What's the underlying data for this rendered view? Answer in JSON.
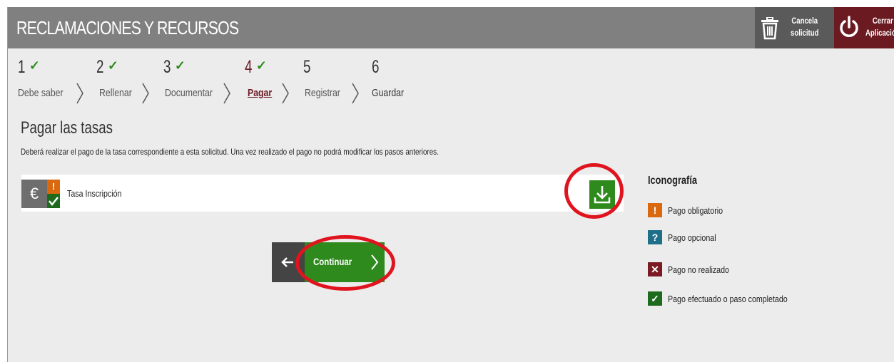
{
  "header": {
    "title": "RECLAMACIONES Y RECURSOS",
    "cancel_label_line1": "Cancela",
    "cancel_label_line2": "solicitud",
    "close_label_line1": "Cerrar",
    "close_label_line2": "Aplicación"
  },
  "steps": [
    {
      "number": "1",
      "label": "Debe saber",
      "completed": true,
      "current": false
    },
    {
      "number": "2",
      "label": "Rellenar",
      "completed": true,
      "current": false
    },
    {
      "number": "3",
      "label": "Documentar",
      "completed": true,
      "current": false
    },
    {
      "number": "4",
      "label": "Pagar",
      "completed": true,
      "current": true
    },
    {
      "number": "5",
      "label": "Registrar",
      "completed": false,
      "current": false
    },
    {
      "number": "6",
      "label": "Guardar",
      "completed": false,
      "current": false
    }
  ],
  "check_symbol": "✓",
  "section": {
    "title": "Pagar las tasas",
    "description": "Deberá realizar el pago de la tasa correspondiente a esta solicitud. Una vez realizado el pago no podrá modificar los pasos anteriores."
  },
  "fee": {
    "currency_symbol": "€",
    "mandatory_symbol": "!",
    "label": "Tasa Inscripción"
  },
  "legend": {
    "title": "Iconografía",
    "items": [
      {
        "symbol": "!",
        "label": "Pago obligatorio",
        "color": "#d9680f"
      },
      {
        "symbol": "?",
        "label": "Pago opcional",
        "color": "#1f6f8b"
      },
      {
        "symbol": "✕",
        "label": "Pago no realizado",
        "color": "#7a1a22"
      },
      {
        "symbol": "✓",
        "label": "Pago efectuado o paso completado",
        "color": "#1e6b1e"
      }
    ]
  },
  "actions": {
    "continue_label": "Continuar"
  },
  "colors": {
    "header": "#808080",
    "accent": "#6b1a22",
    "success": "#2f8a1e",
    "warning": "#d9680f",
    "highlight": "#e0141e"
  }
}
